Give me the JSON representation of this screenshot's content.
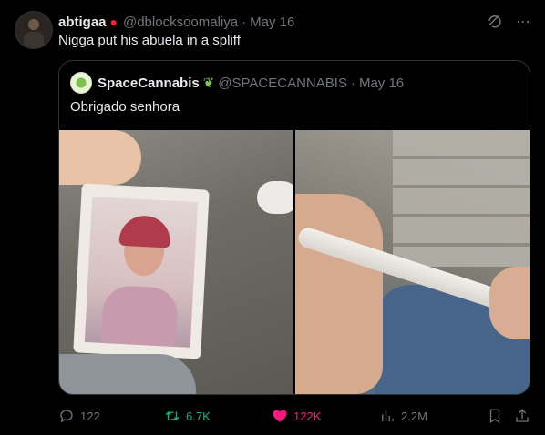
{
  "post": {
    "display_name": "abtigaa",
    "badge_icon": "apple-emoji-icon",
    "handle": "@dblocksoomaliya",
    "separator": "·",
    "date": "May 16",
    "text": "Nigga put his abuela in a spliff",
    "header_icons": [
      "grok-icon",
      "more-icon"
    ]
  },
  "quoted": {
    "display_name": "SpaceCannabis",
    "badge_icon": "leaf-icon",
    "handle": "@SPACECANNABIS",
    "separator": "·",
    "date": "May 16",
    "text": "Obrigado senhora",
    "media": [
      "photo-of-woman-image",
      "rolled-joint-image"
    ]
  },
  "actions": {
    "replies": "122",
    "reposts": "6.7K",
    "likes": "122K",
    "views": "2.2M"
  },
  "colors": {
    "background": "#000000",
    "text": "#e7e9ea",
    "muted": "#71767b",
    "border": "#2f3336",
    "repost": "#00ba7c",
    "like": "#f91880"
  }
}
